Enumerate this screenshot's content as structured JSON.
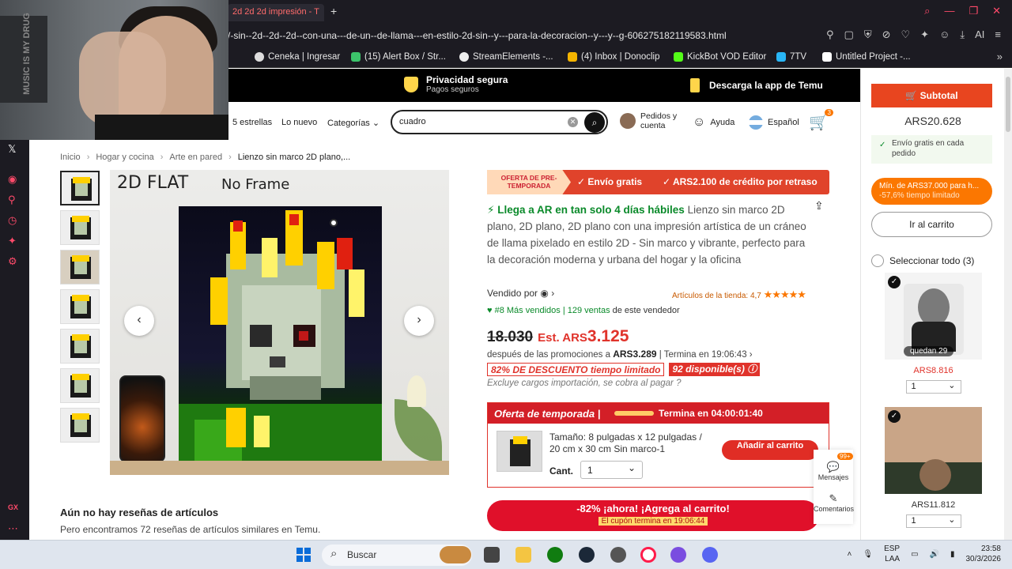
{
  "browser": {
    "tab_title": "2d 2d 2d impresión - T",
    "url": "/-sin--2d--2d--2d--con-una---de-un--de-llama---en-estilo-2d-sin--y---para-la-decoracion--y---y--g-606275182119583.html",
    "bookmarks": [
      "Ceneka | Ingresar",
      "(15) Alert Box / Str...",
      "StreamElements -...",
      "(4) Inbox | Donoclip",
      "KickBot VOD Editor",
      "7TV",
      "Untitled Project -..."
    ],
    "sidebar_label": "GX"
  },
  "webcam": {
    "poster_text": "MUSIC IS MY DRUG"
  },
  "temu": {
    "banner_privacy_title": "Privacidad segura",
    "banner_privacy_sub": "Pagos seguros",
    "banner_app": "Descarga la app de Temu",
    "nav_stars": "5 estrellas",
    "nav_new": "Lo nuevo",
    "nav_categories": "Categorías",
    "search_value": "cuadro",
    "account_l1": "Pedidos y",
    "account_l2": "cuenta",
    "help": "Ayuda",
    "language": "Español",
    "cart_count": "3"
  },
  "breadcrumb": [
    "Inicio",
    "Hogar y cocina",
    "Arte en pared",
    "Lienzo sin marco 2D plano,..."
  ],
  "image": {
    "label1": "2D FLAT",
    "label2": "No Frame"
  },
  "product": {
    "promo_tag": "OFERTA DE PRE-TEMPORADA",
    "promo_free": "✓ Envío gratis",
    "promo_credit": "✓ ARS2.100 de crédito por retraso",
    "arrival": "Llega a AR en tan solo 4 días hábiles",
    "title": " Lienzo sin marco 2D plano, 2D plano, 2D plano con una impresión artística de un cráneo de llama pixelado en estilo 2D - Sin marco y vibrante, perfecto para la decoración moderna y urbana del hogar y la oficina",
    "sold_by": "Vendido por",
    "store_rating": "Artículos de la tienda: 4,7",
    "rank": "#8 Más vendidos",
    "sales": "129 ventas",
    "sales_suffix": "de este vendedor",
    "price_old": "18.030",
    "price_est": "Est. ARS",
    "price_now": "3.125",
    "after_promo": "después de las promociones a",
    "after_price": "ARS3.289",
    "ends_in": "| Termina en  19:06:43 ›",
    "discount": "82% DE DESCUENTO tiempo limitado",
    "available": "92 disponible(s)",
    "exclude": "Excluye cargos importación, se cobra al pagar"
  },
  "offer": {
    "title": "Oferta de temporada |",
    "ends": "Termina en 04:00:01:40",
    "size": "Tamaño: 8 pulgadas x 12 pulgadas / 20 cm x 30 cm Sin marco-1",
    "qty_label": "Cant.",
    "qty_value": "1",
    "add_btn": "Añadir al carrito"
  },
  "cta": {
    "main": "-82% ¡ahora! ¡Agrega al carrito!",
    "coupon": "El cupón termina en 19:06:44"
  },
  "float": {
    "messages": "Mensajes",
    "messages_badge": "99+",
    "comments": "Comentarios"
  },
  "reviews": {
    "title": "Aún no hay reseñas de artículos",
    "subtitle": "Pero encontramos 72 reseñas de artículos similares en Temu."
  },
  "cart": {
    "subtotal_label": "Subtotal",
    "subtotal_value": "ARS20.628",
    "free_shipping": "Envío gratis en cada pedido",
    "min_line1": "Mín. de ARS37.000 para h...",
    "min_line2": "-57,6% tiempo limitado",
    "go_cart": "Ir al carrito",
    "select_all": "Seleccionar todo (3)",
    "items": [
      {
        "remaining": "quedan 29",
        "price": "ARS8.816",
        "qty": "1"
      },
      {
        "price": "ARS11.812",
        "qty": "1"
      }
    ]
  },
  "taskbar": {
    "search": "Buscar",
    "lang1": "ESP",
    "lang2": "LAA",
    "time": "23:58",
    "date": "30/3/2026"
  }
}
